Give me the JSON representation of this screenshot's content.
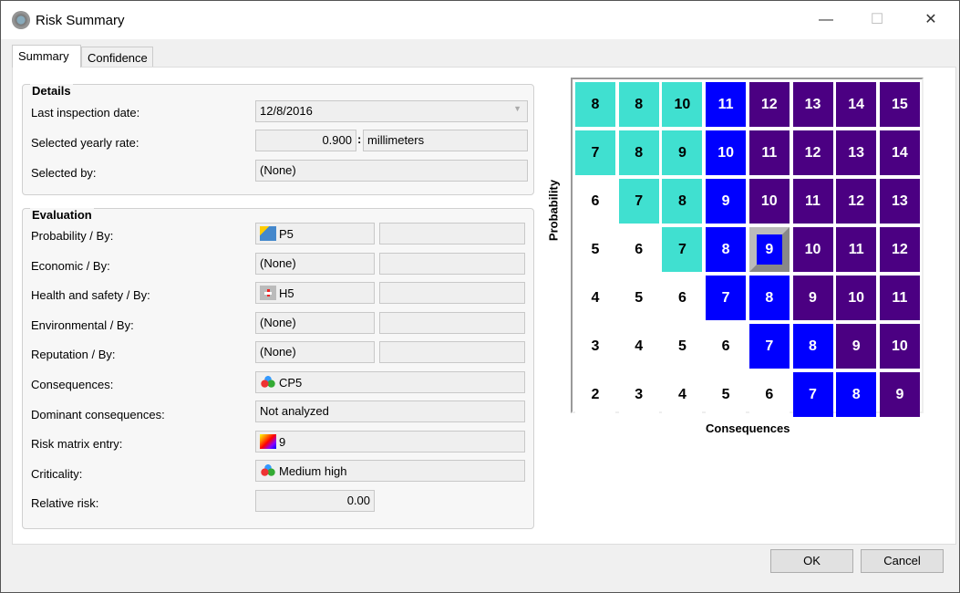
{
  "window": {
    "title": "Risk Summary",
    "minimize": "—",
    "maximize": "☐",
    "close": "✕"
  },
  "tabs": [
    "Summary",
    "Confidence"
  ],
  "details": {
    "title": "Details",
    "last_inspection_label": "Last inspection date:",
    "last_inspection_value": "12/8/2016",
    "yearly_rate_label": "Selected yearly rate:",
    "yearly_rate_value": "0.900",
    "yearly_rate_unit": "millimeters",
    "selected_by_label": "Selected by:",
    "selected_by_value": "(None)"
  },
  "evaluation": {
    "title": "Evaluation",
    "rows": [
      {
        "label": "Probability / By:",
        "value": "P5",
        "by": "",
        "icon": "probability-icon"
      },
      {
        "label": "Economic / By:",
        "value": "(None)",
        "by": ""
      },
      {
        "label": "Health and safety / By:",
        "value": "H5",
        "by": "",
        "icon": "first-aid-kit-icon"
      },
      {
        "label": "Environmental / By:",
        "value": "(None)",
        "by": ""
      },
      {
        "label": "Reputation / By:",
        "value": "(None)",
        "by": ""
      }
    ],
    "consequences_label": "Consequences:",
    "consequences_value": "CP5",
    "dominant_label": "Dominant consequences:",
    "dominant_value": "Not analyzed",
    "matrix_entry_label": "Risk matrix entry:",
    "matrix_entry_value": "9",
    "criticality_label": "Criticality:",
    "criticality_value": "Medium high",
    "relative_risk_label": "Relative risk:",
    "relative_risk_value": "0.00"
  },
  "matrix": {
    "xlabel": "Consequences",
    "ylabel": "Probability",
    "colors": {
      "w": "#ffffff",
      "t": "#40e0d0",
      "b": "#0000ff",
      "p": "#4b0082"
    },
    "selected": [
      3,
      4
    ],
    "rows": [
      [
        [
          8,
          "t"
        ],
        [
          8,
          "t"
        ],
        [
          10,
          "t"
        ],
        [
          11,
          "b"
        ],
        [
          12,
          "p"
        ],
        [
          13,
          "p"
        ],
        [
          14,
          "p"
        ],
        [
          15,
          "p"
        ]
      ],
      [
        [
          7,
          "t"
        ],
        [
          8,
          "t"
        ],
        [
          9,
          "t"
        ],
        [
          10,
          "b"
        ],
        [
          11,
          "p"
        ],
        [
          12,
          "p"
        ],
        [
          13,
          "p"
        ],
        [
          14,
          "p"
        ]
      ],
      [
        [
          6,
          "w"
        ],
        [
          7,
          "t"
        ],
        [
          8,
          "t"
        ],
        [
          9,
          "b"
        ],
        [
          10,
          "p"
        ],
        [
          11,
          "p"
        ],
        [
          12,
          "p"
        ],
        [
          13,
          "p"
        ]
      ],
      [
        [
          5,
          "w"
        ],
        [
          6,
          "w"
        ],
        [
          7,
          "t"
        ],
        [
          8,
          "b"
        ],
        [
          9,
          "b"
        ],
        [
          10,
          "p"
        ],
        [
          11,
          "p"
        ],
        [
          12,
          "p"
        ]
      ],
      [
        [
          4,
          "w"
        ],
        [
          5,
          "w"
        ],
        [
          6,
          "w"
        ],
        [
          7,
          "b"
        ],
        [
          8,
          "b"
        ],
        [
          9,
          "p"
        ],
        [
          10,
          "p"
        ],
        [
          11,
          "p"
        ]
      ],
      [
        [
          3,
          "w"
        ],
        [
          4,
          "w"
        ],
        [
          5,
          "w"
        ],
        [
          6,
          "w"
        ],
        [
          7,
          "b"
        ],
        [
          8,
          "b"
        ],
        [
          9,
          "p"
        ],
        [
          10,
          "p"
        ]
      ],
      [
        [
          2,
          "w"
        ],
        [
          3,
          "w"
        ],
        [
          4,
          "w"
        ],
        [
          5,
          "w"
        ],
        [
          6,
          "w"
        ],
        [
          7,
          "b"
        ],
        [
          8,
          "b"
        ],
        [
          9,
          "p"
        ]
      ]
    ]
  },
  "buttons": {
    "ok": "OK",
    "cancel": "Cancel"
  }
}
